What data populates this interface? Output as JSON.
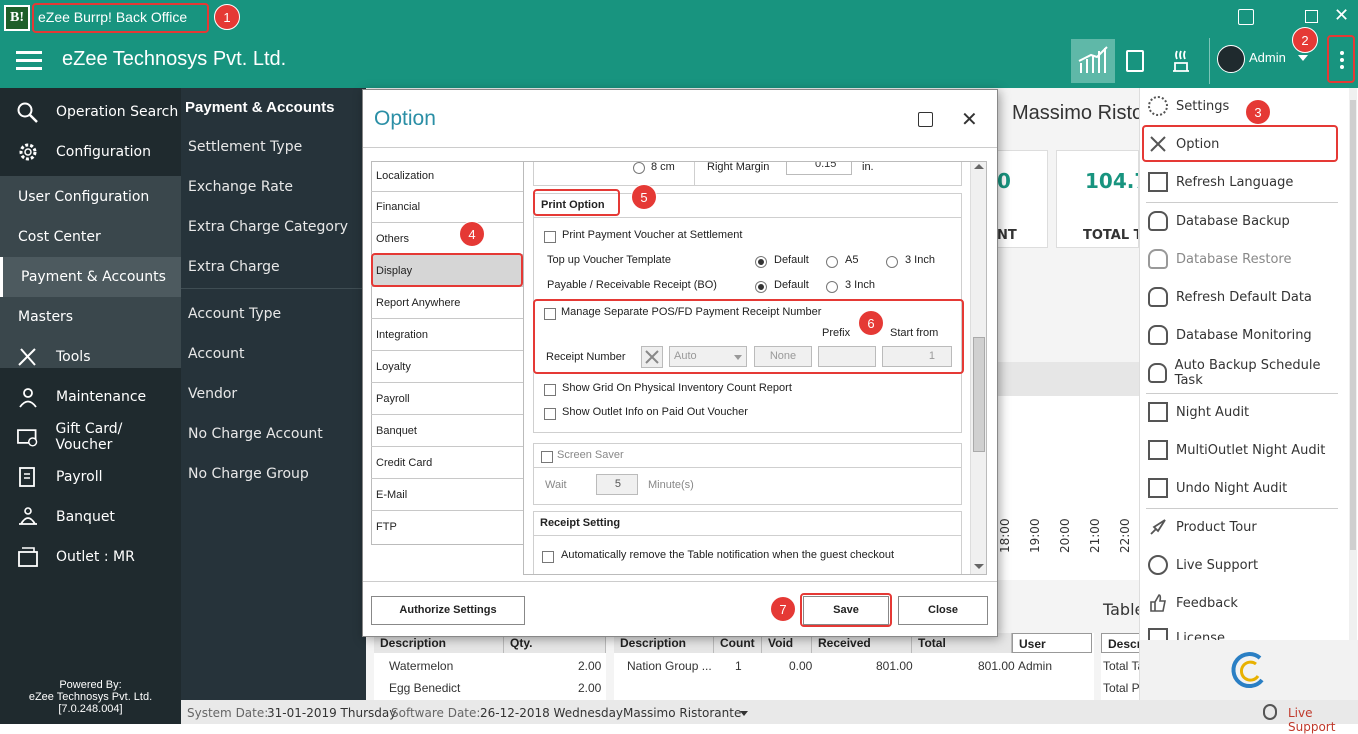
{
  "app": {
    "logo_text": "B!",
    "window_title": "eZee Burrp! Back Office",
    "company": "eZee Technosys Pvt. Ltd.",
    "user": "Admin",
    "accent": "#18947f"
  },
  "callouts": [
    "1",
    "2",
    "3",
    "4",
    "5",
    "6",
    "7"
  ],
  "sidebar": {
    "items": [
      {
        "label": "Operation Search",
        "icon": "search-icon"
      },
      {
        "label": "Configuration",
        "icon": "gear-icon"
      },
      {
        "label": "User Configuration"
      },
      {
        "label": "Cost Center"
      },
      {
        "label": "Payment & Accounts"
      },
      {
        "label": "Masters"
      },
      {
        "label": "Tools",
        "icon": "tools-icon"
      },
      {
        "label": "Maintenance",
        "icon": "maintenance-icon"
      },
      {
        "label": "Gift Card/ Voucher",
        "icon": "gift-card-icon"
      },
      {
        "label": "Payroll",
        "icon": "payroll-icon"
      },
      {
        "label": "Banquet",
        "icon": "banquet-icon"
      },
      {
        "label": "Outlet : MR",
        "icon": "outlet-icon"
      }
    ],
    "powered_by": "Powered By:",
    "powered_company": "eZee Technosys Pvt. Ltd.",
    "version": "[7.0.248.004]"
  },
  "submenu": {
    "title": "Payment & Accounts",
    "items": [
      "Settlement Type",
      "Exchange Rate",
      "Extra Charge Category",
      "Extra Charge",
      "Account Type",
      "Account",
      "Vendor",
      "No Charge Account",
      "No Charge Group"
    ]
  },
  "right_menu": {
    "items": [
      "Settings",
      "Option",
      "Refresh Language",
      "Database Backup",
      "Database Restore",
      "Refresh Default Data",
      "Database Monitoring",
      "Auto Backup Schedule Task",
      "Night Audit",
      "MultiOutlet Night Audit",
      "Undo Night Audit",
      "Product Tour",
      "Live Support",
      "Feedback",
      "License"
    ]
  },
  "background": {
    "restaurant_title": "Massimo Ristorante",
    "stat_value_partial": "0",
    "stat_value": "104.7",
    "stat_label_partial": "NT",
    "stat_label": "TOTAL TA",
    "hours": [
      "18:00",
      "19:00",
      "20:00",
      "21:00",
      "22:00"
    ],
    "table_label": "Table",
    "grid1": {
      "headers": [
        "Description",
        "Qty."
      ],
      "rows": [
        [
          "Watermelon",
          "2.00"
        ],
        [
          "Egg Benedict",
          "2.00"
        ]
      ]
    },
    "grid2": {
      "headers": [
        "Description",
        "Count",
        "Void",
        "Received",
        "Total",
        "User"
      ],
      "rows": [
        [
          "Nation Group ...",
          "1",
          "0.00",
          "801.00",
          "801.00",
          "Admin"
        ]
      ]
    },
    "grid3": {
      "headers": [
        "Descri"
      ],
      "rows": [
        [
          "Total Ta"
        ],
        [
          "Total P"
        ]
      ]
    }
  },
  "status": {
    "system_date_label": "System Date:",
    "system_date": "31-01-2019 Thursday",
    "software_date_label": "Software Date:",
    "software_date": "26-12-2018 Wednesday",
    "outlet": "Massimo Ristorante",
    "live_support": "Live Support"
  },
  "dialog": {
    "title": "Option",
    "categories": [
      "Localization",
      "Financial",
      "Others",
      "Display",
      "Report Anywhere",
      "Integration",
      "Loyalty",
      "Payroll",
      "Banquet",
      "Credit Card",
      "E-Mail",
      "FTP"
    ],
    "selected_category": "Display",
    "top_row": {
      "radio_label": "8 cm",
      "right_margin_label": "Right Margin",
      "right_margin_value": "0.15",
      "unit": "in."
    },
    "print_option": {
      "title": "Print Option",
      "print_payment_voucher": "Print Payment Voucher at Settlement",
      "topup_label": "Top up Voucher Template",
      "topup_options": [
        "Default",
        "A5",
        "3 Inch"
      ],
      "topup_selected": "Default",
      "payable_label": "Payable / Receivable Receipt (BO)",
      "payable_options": [
        "Default",
        "3 Inch"
      ],
      "payable_selected": "Default",
      "manage_separate": "Manage Separate POS/FD Payment Receipt Number",
      "prefix_label": "Prefix",
      "start_from_label": "Start from",
      "receipt_number_label": "Receipt Number",
      "receipt_mode": "Auto",
      "receipt_none": "None",
      "start_from_value": "1",
      "show_grid": "Show Grid On Physical Inventory Count Report",
      "show_outlet": "Show Outlet Info on Paid Out Voucher"
    },
    "screen_saver": {
      "title": "Screen Saver",
      "wait_label": "Wait",
      "wait_value": "5",
      "unit": "Minute(s)"
    },
    "receipt_setting": {
      "title": "Receipt Setting",
      "auto_remove": "Automatically remove the Table notification when the guest checkout"
    },
    "buttons": {
      "authorize": "Authorize Settings",
      "save": "Save",
      "close": "Close"
    }
  }
}
